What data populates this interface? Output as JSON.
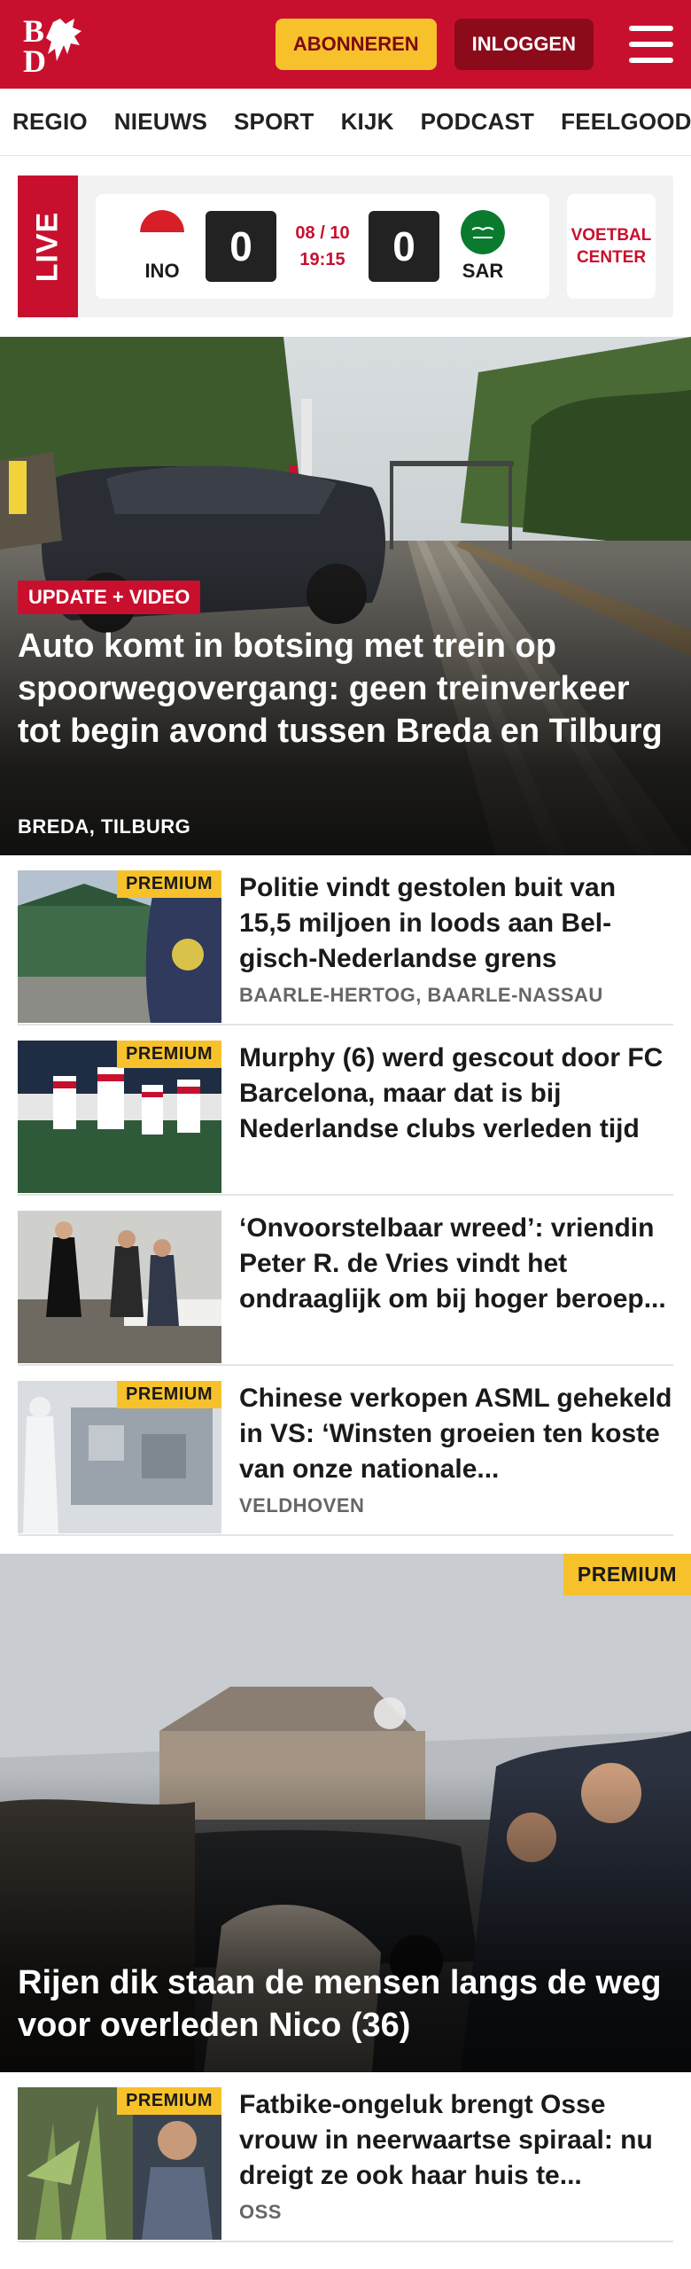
{
  "header": {
    "logo_text": "BD",
    "subscribe_label": "ABONNEREN",
    "login_label": "INLOGGEN",
    "brand_color": "#c8102e"
  },
  "nav": {
    "items": [
      "REGIO",
      "NIEUWS",
      "SPORT",
      "KIJK",
      "PODCAST",
      "FEELGOOD"
    ]
  },
  "live": {
    "label": "LIVE",
    "home_code": "INO",
    "home_score": "0",
    "date": "08 / 10",
    "time": "19:15",
    "away_score": "0",
    "away_code": "SAR",
    "voetbal_line1": "VOETBAL",
    "voetbal_line2": "CENTER"
  },
  "hero": {
    "badge": "UPDATE + VIDEO",
    "title": "Auto komt in botsing met trein op spoorwegovergang: geen treinverkeer tot begin avond tussen Breda en Tilburg",
    "location": "BREDA, TILBURG"
  },
  "articles": [
    {
      "premium": "PREMIUM",
      "title": "Politie vindt gestolen buit van 15,5 miljoen in loods aan Bel-gisch-Nederlandse grens",
      "location": "BAARLE-HERTOG, BAARLE-NASSAU"
    },
    {
      "premium": "PREMIUM",
      "title": "Murphy (6) werd gescout door FC Barcelona, maar dat is bij Nederlandse clubs verleden tijd",
      "location": ""
    },
    {
      "premium": "",
      "title": "‘Onvoorstelbaar wreed’: vriendin Peter R. de Vries vindt het ondraaglijk om bij hoger beroep...",
      "location": ""
    },
    {
      "premium": "PREMIUM",
      "title": "Chinese verkopen ASML gehekeld in VS: ‘Winsten groeien ten koste van onze nationale...",
      "location": "VELDHOVEN"
    }
  ],
  "feature": {
    "premium": "PREMIUM",
    "title": "Rijen dik staan de mensen langs de weg voor overleden Nico (36)"
  },
  "articles2": [
    {
      "premium": "PREMIUM",
      "title": "Fatbike-ongeluk brengt Osse vrouw in neerwaartse spiraal: nu dreigt ze ook haar huis te...",
      "location": "OSS"
    }
  ]
}
